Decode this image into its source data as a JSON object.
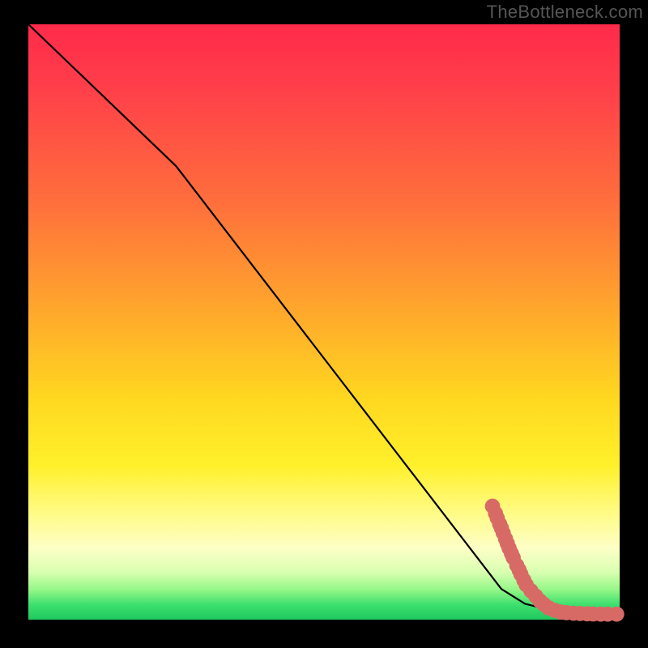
{
  "watermark": "TheBottleneck.com",
  "colors": {
    "background": "#000000",
    "gradient_top": "#ff2a4a",
    "gradient_mid_upper": "#ffa72c",
    "gradient_mid": "#fff02a",
    "gradient_lower": "#3de06e",
    "gradient_bottom": "#1fc85e",
    "curve": "#000000",
    "scatter_point": "#d86a66"
  },
  "chart_data": {
    "type": "line",
    "title": "",
    "xlabel": "",
    "ylabel": "",
    "xlim": [
      0,
      100
    ],
    "ylim": [
      0,
      100
    ],
    "curve_points": [
      {
        "x": 0,
        "y": 100
      },
      {
        "x": 25,
        "y": 76
      },
      {
        "x": 80,
        "y": 4.5
      },
      {
        "x": 84,
        "y": 2.0
      },
      {
        "x": 90,
        "y": 0.5
      },
      {
        "x": 100,
        "y": 0.2
      }
    ],
    "series": [
      {
        "name": "scatter-dense",
        "type": "scatter",
        "size": 6,
        "points": [
          {
            "x": 78.5,
            "y": 18.5
          },
          {
            "x": 79.0,
            "y": 17.3
          },
          {
            "x": 79.3,
            "y": 16.5
          },
          {
            "x": 79.7,
            "y": 15.5
          },
          {
            "x": 80.0,
            "y": 14.8
          },
          {
            "x": 80.3,
            "y": 14.0
          },
          {
            "x": 80.7,
            "y": 13.0
          },
          {
            "x": 81.0,
            "y": 12.2
          },
          {
            "x": 81.3,
            "y": 11.4
          },
          {
            "x": 81.7,
            "y": 10.5
          },
          {
            "x": 82.0,
            "y": 9.8
          },
          {
            "x": 82.6,
            "y": 8.5
          },
          {
            "x": 83.0,
            "y": 7.7
          },
          {
            "x": 83.3,
            "y": 7.0
          },
          {
            "x": 83.8,
            "y": 6.0
          },
          {
            "x": 84.2,
            "y": 5.2
          },
          {
            "x": 85.0,
            "y": 4.2
          },
          {
            "x": 85.8,
            "y": 3.3
          },
          {
            "x": 86.5,
            "y": 2.5
          },
          {
            "x": 87.2,
            "y": 1.9
          }
        ]
      },
      {
        "name": "scatter-tail",
        "type": "scatter",
        "size": 6,
        "points": [
          {
            "x": 88.0,
            "y": 1.3
          },
          {
            "x": 89.0,
            "y": 0.9
          },
          {
            "x": 90.0,
            "y": 0.6
          },
          {
            "x": 91.0,
            "y": 0.5
          },
          {
            "x": 92.2,
            "y": 0.4
          },
          {
            "x": 93.3,
            "y": 0.35
          },
          {
            "x": 94.5,
            "y": 0.3
          },
          {
            "x": 95.5,
            "y": 0.28
          },
          {
            "x": 96.8,
            "y": 0.25
          },
          {
            "x": 98.0,
            "y": 0.25
          },
          {
            "x": 99.5,
            "y": 0.25
          }
        ]
      }
    ]
  }
}
